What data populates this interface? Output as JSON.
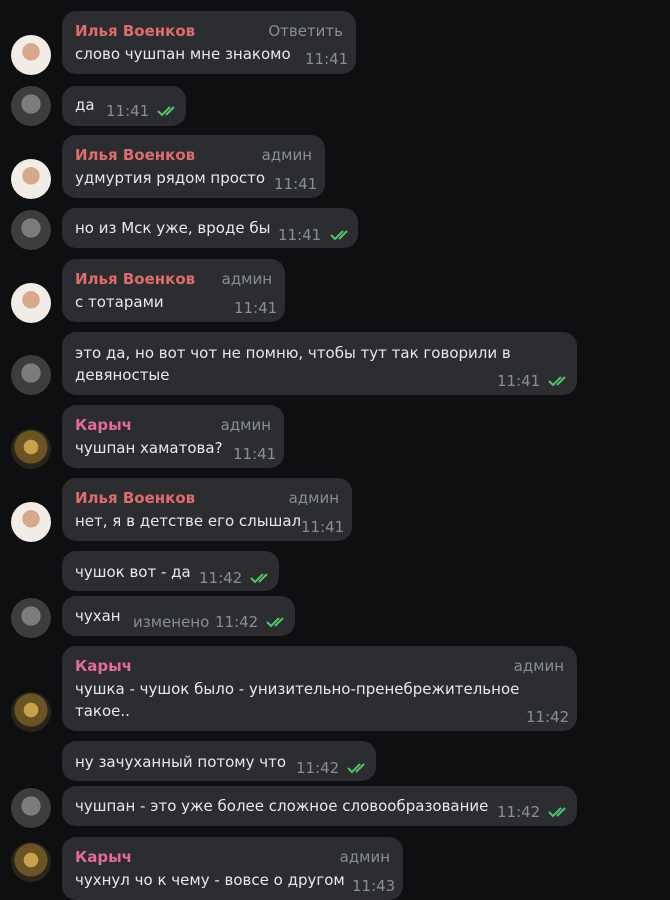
{
  "colors": {
    "background": "#0e0f11",
    "bubble": "#2b2d31",
    "name_ilya": "#e06c6c",
    "name_karych": "#e36b95",
    "text": "#e8e9eb",
    "meta": "#8a8d93",
    "read_check": "#4fc56a"
  },
  "messages": [
    {
      "sender": "Илья Военков",
      "tag": "Ответить",
      "text": "слово чушпан мне знакомо",
      "time": "11:41"
    },
    {
      "text": "да",
      "time": "11:41",
      "read": true
    },
    {
      "sender": "Илья Военков",
      "tag": "админ",
      "text": "удмуртия рядом просто",
      "time": "11:41"
    },
    {
      "text": "но из Мск уже, вроде бы",
      "time": "11:41",
      "read": true
    },
    {
      "sender": "Илья Военков",
      "tag": "админ",
      "text": "с тотарами",
      "time": "11:41"
    },
    {
      "text_lines": [
        "это да, но вот чот не помню, чтобы тут так говорили в",
        "девяностые"
      ],
      "time": "11:41",
      "read": true
    },
    {
      "sender": "Карыч",
      "tag": "админ",
      "text": "чушпан хаматова?",
      "time": "11:41"
    },
    {
      "sender": "Илья Военков",
      "tag": "админ",
      "text": "нет, я в детстве его слышал",
      "time": "11:41"
    },
    {
      "text": "чушок вот - да",
      "time": "11:42",
      "read": true
    },
    {
      "text": "чухан",
      "edited": "изменено",
      "time": "11:42",
      "read": true
    },
    {
      "sender": "Карыч",
      "tag": "админ",
      "text_lines": [
        "чушка - чушок было - унизительно-пренебрежительное",
        "такое.."
      ],
      "time": "11:42"
    },
    {
      "text": "ну зачуханный потому что",
      "time": "11:42",
      "read": true
    },
    {
      "text": "чушпан - это уже более сложное словообразование",
      "time": "11:42",
      "read": true
    },
    {
      "sender": "Карыч",
      "tag": "админ",
      "text": "чухнул чо к чему - вовсе о другом",
      "time": "11:43"
    }
  ]
}
